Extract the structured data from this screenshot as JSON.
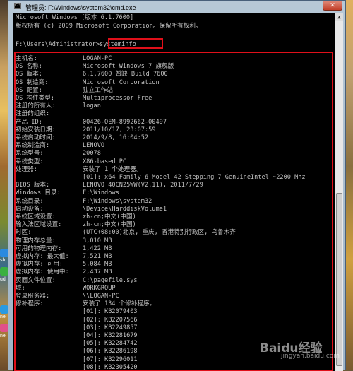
{
  "window": {
    "title": "管理员: F:\\Windows\\system32\\cmd.exe",
    "icon_glyph": "C:\\",
    "close_glyph": "✕"
  },
  "header_lines": [
    "Microsoft Windows [版本 6.1.7600]",
    "版权所有 (c) 2009 Microsoft Corporation。保留所有权利。"
  ],
  "prompt": {
    "path": "F:\\Users\\Administrator>",
    "command": "systeminfo"
  },
  "info_rows": [
    {
      "label": "主机名:",
      "value": "LOGAN-PC"
    },
    {
      "label": "OS 名称:",
      "value": "Microsoft Windows 7 旗舰版"
    },
    {
      "label": "OS 版本:",
      "value": "6.1.7600 暂缺 Build 7600"
    },
    {
      "label": "OS 制造商:",
      "value": "Microsoft Corporation"
    },
    {
      "label": "OS 配置:",
      "value": "独立工作站"
    },
    {
      "label": "OS 构件类型:",
      "value": "Multiprocessor Free"
    },
    {
      "label": "注册的所有人:",
      "value": "logan"
    },
    {
      "label": "注册的组织:",
      "value": ""
    },
    {
      "label": "产品 ID:",
      "value": "00426-OEM-8992662-00497"
    },
    {
      "label": "初始安装日期:",
      "value": "2011/10/17, 23:07:59"
    },
    {
      "label": "系统启动时间:",
      "value": "2014/9/8, 16:04:52"
    },
    {
      "label": "系统制造商:",
      "value": "LENOVO"
    },
    {
      "label": "系统型号:",
      "value": "20078"
    },
    {
      "label": "系统类型:",
      "value": "X86-based PC"
    },
    {
      "label": "处理器:",
      "value": "安装了 1 个处理器。"
    },
    {
      "label": "",
      "value": "[01]: x64 Family 6 Model 42 Stepping 7 GenuineIntel ~2200 Mhz"
    },
    {
      "label": "BIOS 版本:",
      "value": "LENOVO 40CN25WW(V2.11), 2011/7/29"
    },
    {
      "label": "Windows 目录:",
      "value": "F:\\Windows"
    },
    {
      "label": "系统目录:",
      "value": "F:\\Windows\\system32"
    },
    {
      "label": "启动设备:",
      "value": "\\Device\\HarddiskVolume1"
    },
    {
      "label": "系统区域设置:",
      "value": "zh-cn;中文(中国)"
    },
    {
      "label": "输入法区域设置:",
      "value": "zh-cn;中文(中国)"
    },
    {
      "label": "时区:",
      "value": "(UTC+08:00)北京, 重庆, 香港特别行政区, 乌鲁木齐"
    },
    {
      "label": "物理内存总量:",
      "value": "3,010 MB"
    },
    {
      "label": "可用的物理内存:",
      "value": "1,422 MB"
    },
    {
      "label": "虚拟内存: 最大值:",
      "value": "7,521 MB"
    },
    {
      "label": "虚拟内存: 可用:",
      "value": "5,084 MB"
    },
    {
      "label": "虚拟内存: 使用中:",
      "value": "2,437 MB"
    },
    {
      "label": "页面文件位置:",
      "value": "C:\\pagefile.sys"
    },
    {
      "label": "域:",
      "value": "WORKGROUP"
    },
    {
      "label": "登录服务器:",
      "value": "\\\\LOGAN-PC"
    },
    {
      "label": "修补程序:",
      "value": "安装了 134 个修补程序。"
    },
    {
      "label": "",
      "value": "[01]: KB2079403"
    },
    {
      "label": "",
      "value": "[02]: KB2207566"
    },
    {
      "label": "",
      "value": "[03]: KB2249857"
    },
    {
      "label": "",
      "value": "[04]: KB2281679"
    },
    {
      "label": "",
      "value": "[05]: KB2284742"
    },
    {
      "label": "",
      "value": "[06]: KB2286198"
    },
    {
      "label": "",
      "value": "[07]: KB2296011"
    },
    {
      "label": "",
      "value": "[08]: KB2305420"
    }
  ],
  "desktop": {
    "left_labels": [
      "sh",
      "udi",
      "ne",
      "ne"
    ]
  },
  "watermark": {
    "text": "Baidu经验",
    "sub": "jingyan.baidu.com"
  },
  "colors": {
    "highlight": "#e0101a",
    "console_bg": "#000000",
    "console_text": "#c0c0c0"
  }
}
